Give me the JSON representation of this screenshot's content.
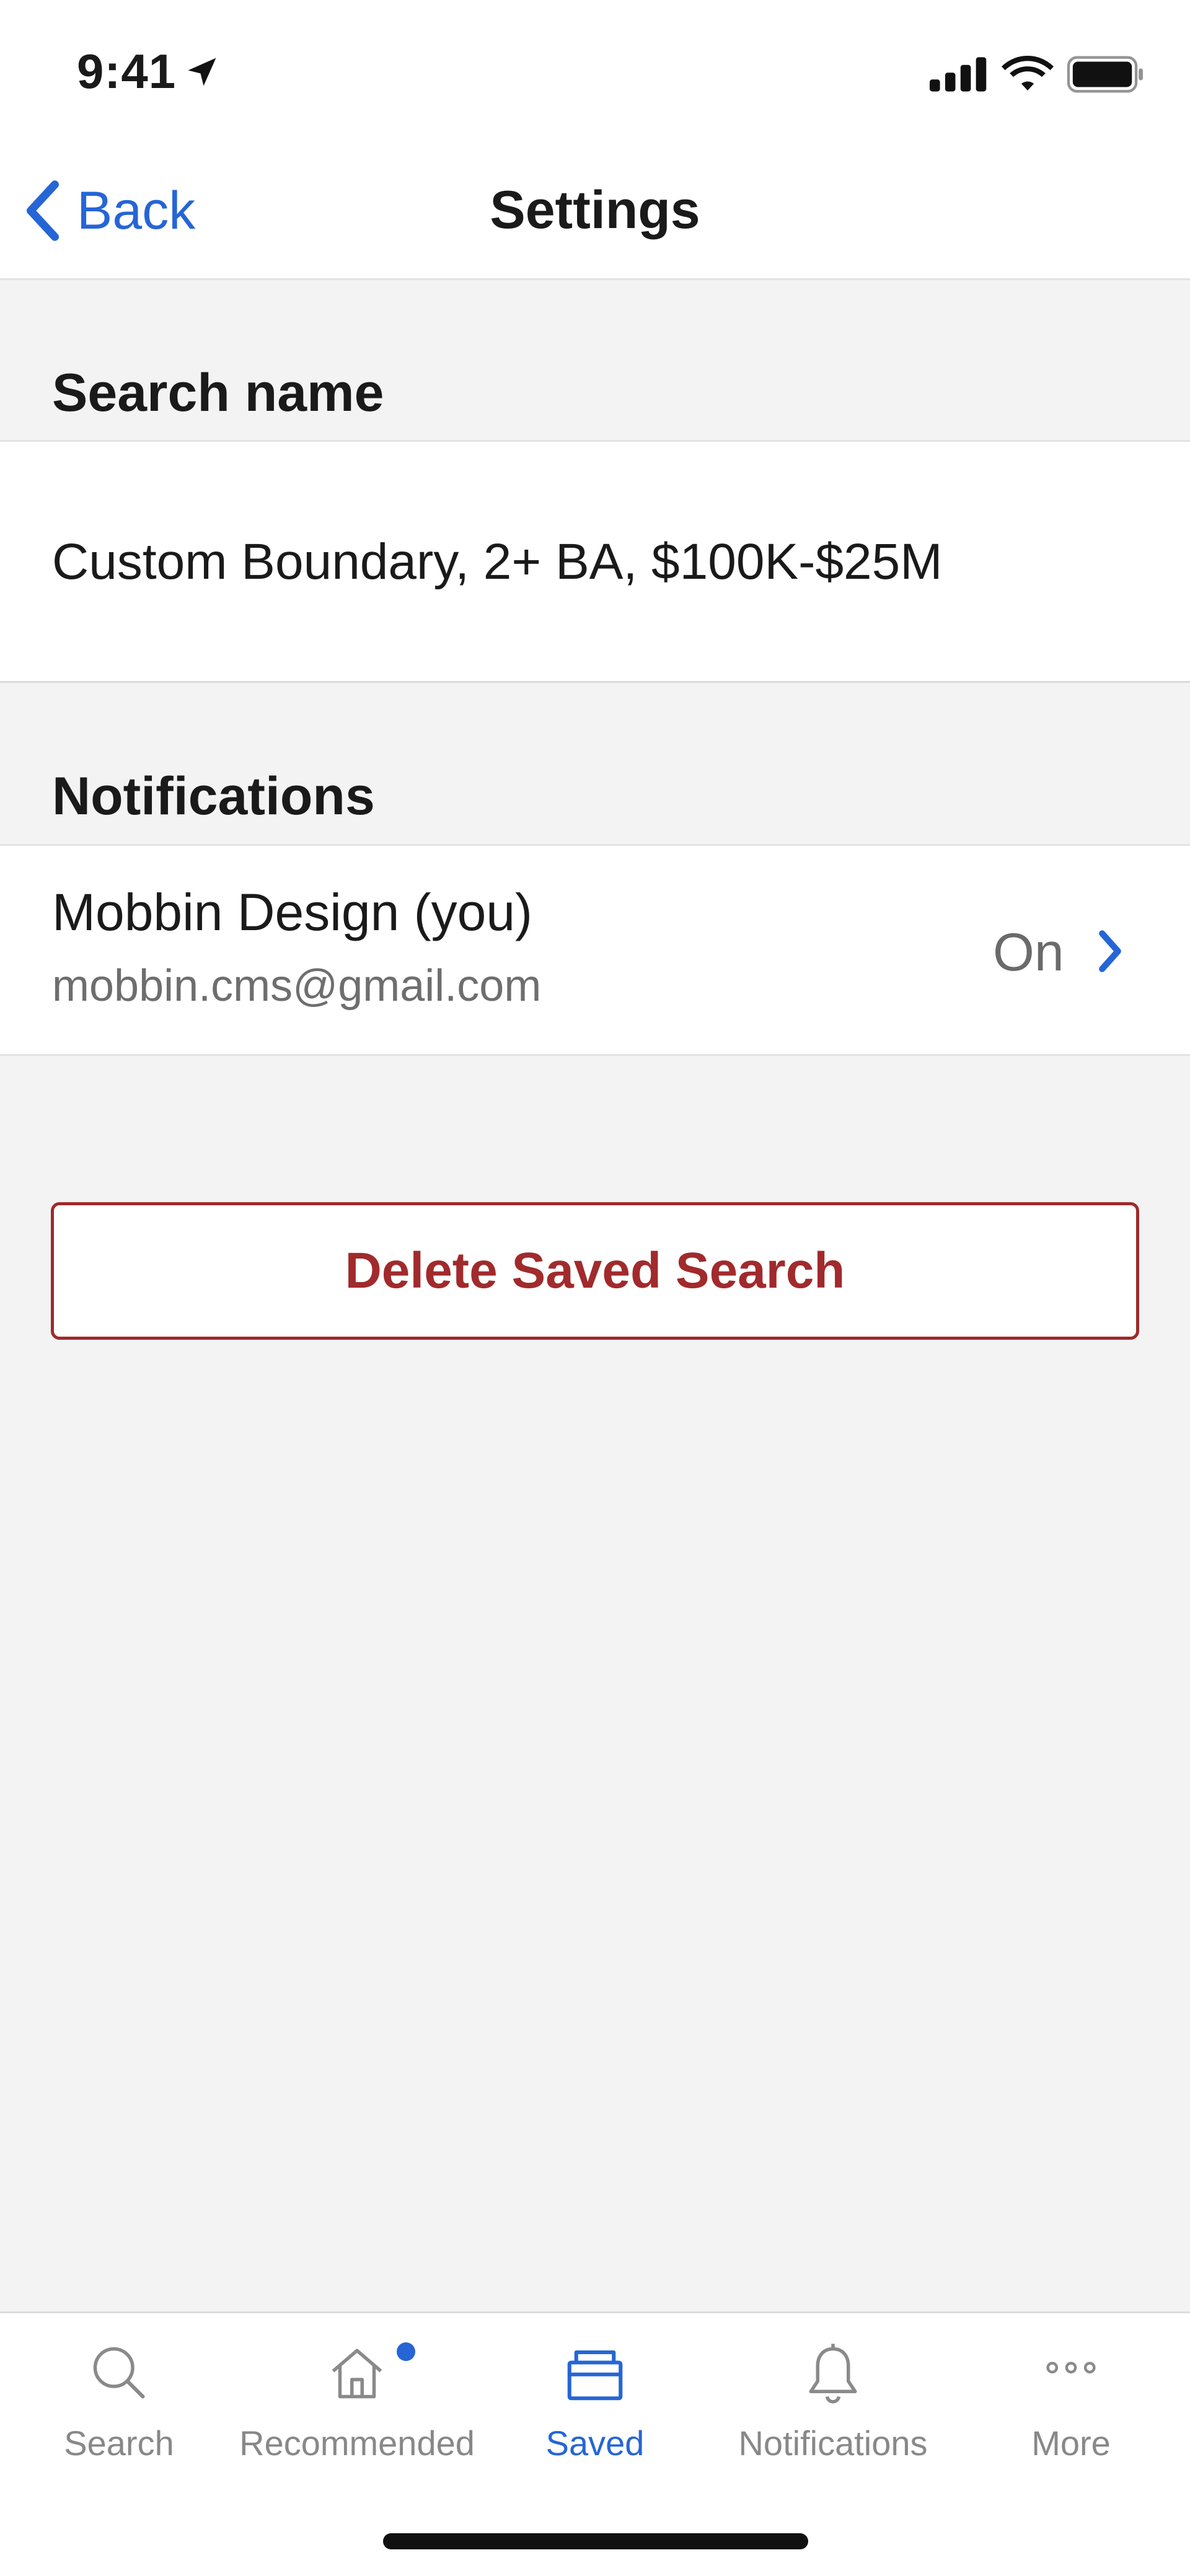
{
  "status_bar": {
    "time": "9:41"
  },
  "nav": {
    "back_label": "Back",
    "title": "Settings"
  },
  "search_name": {
    "header": "Search name",
    "value": "Custom Boundary, 2+ BA, $100K-$25M"
  },
  "notifications": {
    "header": "Notifications",
    "user_name": "Mobbin  Design (you)",
    "email": "mobbin.cms@gmail.com",
    "status": "On"
  },
  "delete_button": {
    "label": "Delete Saved Search"
  },
  "tab_bar": {
    "tabs": [
      {
        "label": "Search",
        "icon": "search-icon"
      },
      {
        "label": "Recommended",
        "icon": "home-icon"
      },
      {
        "label": "Saved",
        "icon": "folder-icon",
        "active": true
      },
      {
        "label": "Notifications",
        "icon": "bell-icon"
      },
      {
        "label": "More",
        "icon": "more-icon"
      }
    ]
  },
  "colors": {
    "accent": "#2565d6",
    "danger": "#a12a2c",
    "background": "#f3f3f3"
  }
}
